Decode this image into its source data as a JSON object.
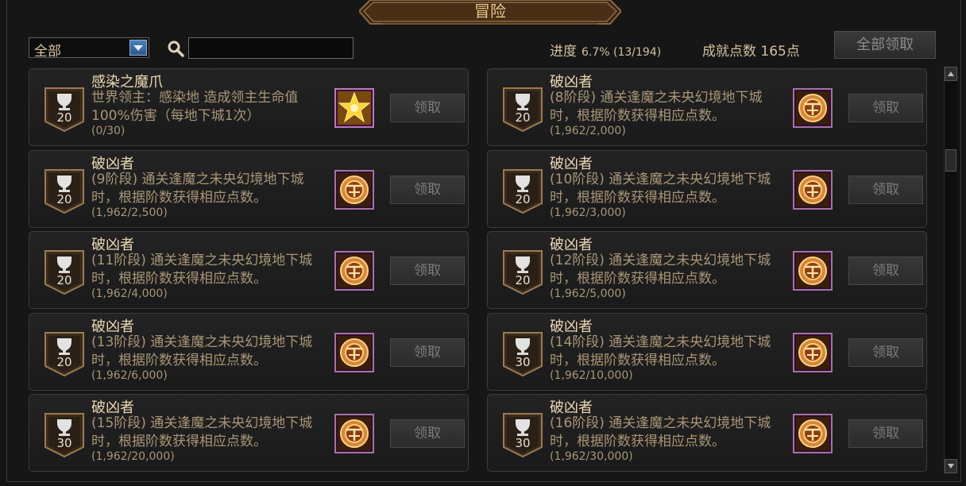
{
  "window": {
    "title": "冒险"
  },
  "filter": {
    "selected": "全部",
    "search_placeholder": ""
  },
  "summary": {
    "progress_label": "进度",
    "progress_value": "6.7% (13/194)",
    "points_label": "成就点数 165点",
    "claim_all_label": "全部领取"
  },
  "achievements": [
    {
      "points": "20",
      "name": "感染之魔爪",
      "desc": "世界领主：感染地        造成领主生命值100%伤害（每地下城1次）",
      "progress": "(0/30)",
      "reward": "gold-star-icon",
      "claim": "领取"
    },
    {
      "points": "20",
      "name": "破凶者",
      "desc": "(8阶段) 通关逢魔之未央幻境地下城时，根据阶数获得相应点数。",
      "progress": "(1,962/2,000)",
      "reward": "emblem-icon",
      "claim": "领取"
    },
    {
      "points": "20",
      "name": "破凶者",
      "desc": "(9阶段) 通关逢魔之未央幻境地下城时，根据阶数获得相应点数。",
      "progress": "(1,962/2,500)",
      "reward": "emblem-icon",
      "claim": "领取"
    },
    {
      "points": "20",
      "name": "破凶者",
      "desc": "(10阶段) 通关逢魔之未央幻境地下城时，根据阶数获得相应点数。",
      "progress": "(1,962/3,000)",
      "reward": "emblem-icon",
      "claim": "领取"
    },
    {
      "points": "20",
      "name": "破凶者",
      "desc": "(11阶段) 通关逢魔之未央幻境地下城时，根据阶数获得相应点数。",
      "progress": "(1,962/4,000)",
      "reward": "emblem-icon",
      "claim": "领取"
    },
    {
      "points": "20",
      "name": "破凶者",
      "desc": "(12阶段) 通关逢魔之未央幻境地下城时，根据阶数获得相应点数。",
      "progress": "(1,962/5,000)",
      "reward": "emblem-icon",
      "claim": "领取"
    },
    {
      "points": "20",
      "name": "破凶者",
      "desc": "(13阶段) 通关逢魔之未央幻境地下城时，根据阶数获得相应点数。",
      "progress": "(1,962/6,000)",
      "reward": "emblem-icon",
      "claim": "领取"
    },
    {
      "points": "30",
      "name": "破凶者",
      "desc": "(14阶段) 通关逢魔之未央幻境地下城时，根据阶数获得相应点数。",
      "progress": "(1,962/10,000)",
      "reward": "emblem-icon",
      "claim": "领取"
    },
    {
      "points": "30",
      "name": "破凶者",
      "desc": "(15阶段) 通关逢魔之未央幻境地下城时，根据阶数获得相应点数。",
      "progress": "(1,962/20,000)",
      "reward": "emblem-icon",
      "claim": "领取"
    },
    {
      "points": "30",
      "name": "破凶者",
      "desc": "(16阶段) 通关逢魔之未央幻境地下城时，根据阶数获得相应点数。",
      "progress": "(1,962/30,000)",
      "reward": "emblem-icon",
      "claim": "领取"
    }
  ]
}
